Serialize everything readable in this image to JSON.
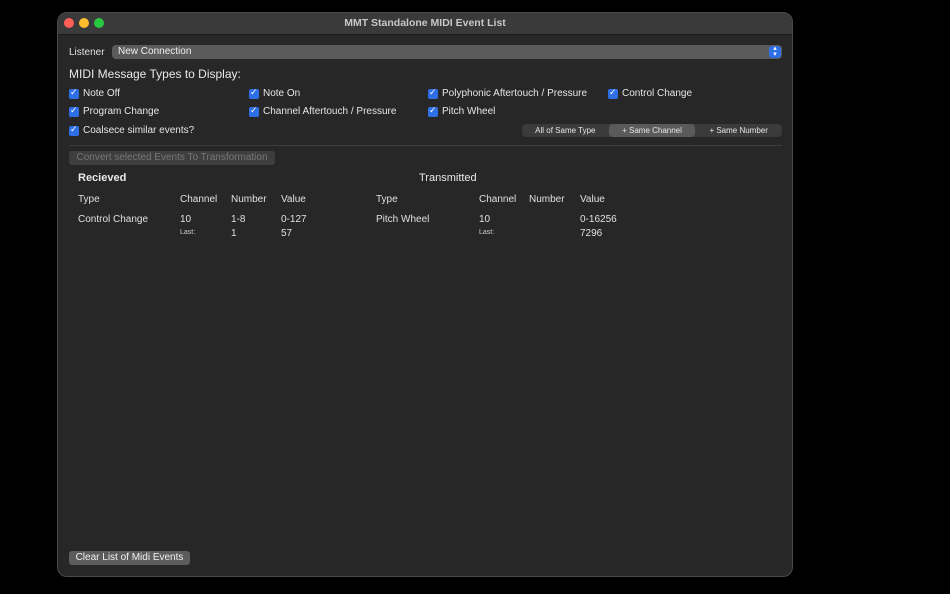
{
  "window": {
    "title": "MMT Standalone MIDI Event List"
  },
  "listener": {
    "label": "Listener",
    "value": "New Connection"
  },
  "types_heading": "MIDI Message Types to Display:",
  "checkboxes": {
    "note_off": "Note Off",
    "note_on": "Note On",
    "poly_aftertouch": "Polyphonic Aftertouch / Pressure",
    "control_change": "Control Change",
    "program_change": "Program Change",
    "channel_aftertouch": "Channel Aftertouch / Pressure",
    "pitch_wheel": "Pitch Wheel",
    "coalesce": "Coalsece similar events?"
  },
  "segmented": {
    "all_same_type": "All of Same Type",
    "same_channel": "+ Same Channel",
    "same_number": "+ Same Number",
    "selected": "+ Same Channel"
  },
  "convert_button": "Convert selected Events To Transformation",
  "received": {
    "heading": "Recieved",
    "columns": {
      "type": "Type",
      "channel": "Channel",
      "number": "Number",
      "value": "Value"
    },
    "row": {
      "type": "Control Change",
      "channel": "10",
      "number": "1-8",
      "value": "0-127",
      "last_label": "Last:",
      "last_number": "1",
      "last_value": "57"
    }
  },
  "transmitted": {
    "heading": "Transmitted",
    "columns": {
      "type": "Type",
      "channel": "Channel",
      "number": "Number",
      "value": "Value"
    },
    "row": {
      "type": "Pitch Wheel",
      "channel": "10",
      "value": "0-16256",
      "last_label": "Last:",
      "last_value": "7296"
    }
  },
  "clear_button": "Clear List of Midi Events",
  "colors": {
    "accent": "#2f6fe6",
    "window_bg": "#272727"
  }
}
